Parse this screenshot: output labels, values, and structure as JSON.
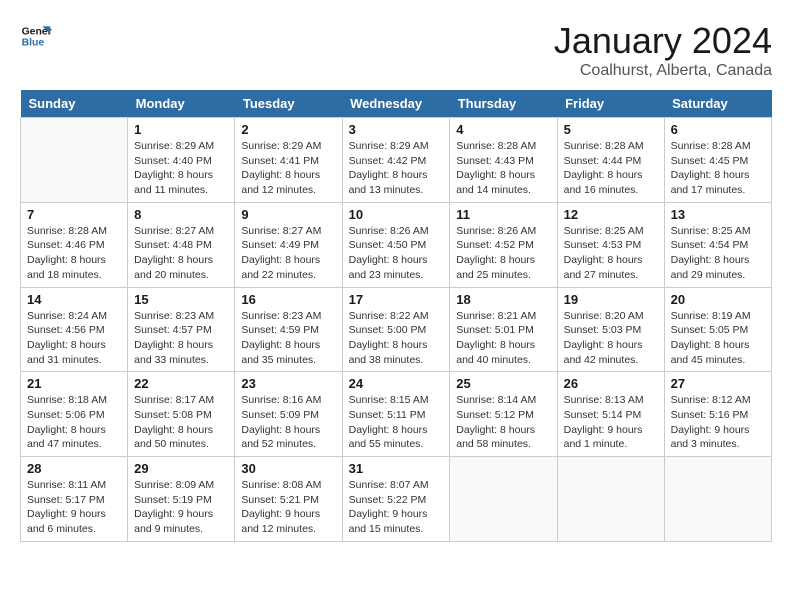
{
  "logo": {
    "line1": "General",
    "line2": "Blue"
  },
  "title": "January 2024",
  "subtitle": "Coalhurst, Alberta, Canada",
  "days_of_week": [
    "Sunday",
    "Monday",
    "Tuesday",
    "Wednesday",
    "Thursday",
    "Friday",
    "Saturday"
  ],
  "weeks": [
    [
      {
        "day": "",
        "info": ""
      },
      {
        "day": "1",
        "info": "Sunrise: 8:29 AM\nSunset: 4:40 PM\nDaylight: 8 hours\nand 11 minutes."
      },
      {
        "day": "2",
        "info": "Sunrise: 8:29 AM\nSunset: 4:41 PM\nDaylight: 8 hours\nand 12 minutes."
      },
      {
        "day": "3",
        "info": "Sunrise: 8:29 AM\nSunset: 4:42 PM\nDaylight: 8 hours\nand 13 minutes."
      },
      {
        "day": "4",
        "info": "Sunrise: 8:28 AM\nSunset: 4:43 PM\nDaylight: 8 hours\nand 14 minutes."
      },
      {
        "day": "5",
        "info": "Sunrise: 8:28 AM\nSunset: 4:44 PM\nDaylight: 8 hours\nand 16 minutes."
      },
      {
        "day": "6",
        "info": "Sunrise: 8:28 AM\nSunset: 4:45 PM\nDaylight: 8 hours\nand 17 minutes."
      }
    ],
    [
      {
        "day": "7",
        "info": "Sunrise: 8:28 AM\nSunset: 4:46 PM\nDaylight: 8 hours\nand 18 minutes."
      },
      {
        "day": "8",
        "info": "Sunrise: 8:27 AM\nSunset: 4:48 PM\nDaylight: 8 hours\nand 20 minutes."
      },
      {
        "day": "9",
        "info": "Sunrise: 8:27 AM\nSunset: 4:49 PM\nDaylight: 8 hours\nand 22 minutes."
      },
      {
        "day": "10",
        "info": "Sunrise: 8:26 AM\nSunset: 4:50 PM\nDaylight: 8 hours\nand 23 minutes."
      },
      {
        "day": "11",
        "info": "Sunrise: 8:26 AM\nSunset: 4:52 PM\nDaylight: 8 hours\nand 25 minutes."
      },
      {
        "day": "12",
        "info": "Sunrise: 8:25 AM\nSunset: 4:53 PM\nDaylight: 8 hours\nand 27 minutes."
      },
      {
        "day": "13",
        "info": "Sunrise: 8:25 AM\nSunset: 4:54 PM\nDaylight: 8 hours\nand 29 minutes."
      }
    ],
    [
      {
        "day": "14",
        "info": "Sunrise: 8:24 AM\nSunset: 4:56 PM\nDaylight: 8 hours\nand 31 minutes."
      },
      {
        "day": "15",
        "info": "Sunrise: 8:23 AM\nSunset: 4:57 PM\nDaylight: 8 hours\nand 33 minutes."
      },
      {
        "day": "16",
        "info": "Sunrise: 8:23 AM\nSunset: 4:59 PM\nDaylight: 8 hours\nand 35 minutes."
      },
      {
        "day": "17",
        "info": "Sunrise: 8:22 AM\nSunset: 5:00 PM\nDaylight: 8 hours\nand 38 minutes."
      },
      {
        "day": "18",
        "info": "Sunrise: 8:21 AM\nSunset: 5:01 PM\nDaylight: 8 hours\nand 40 minutes."
      },
      {
        "day": "19",
        "info": "Sunrise: 8:20 AM\nSunset: 5:03 PM\nDaylight: 8 hours\nand 42 minutes."
      },
      {
        "day": "20",
        "info": "Sunrise: 8:19 AM\nSunset: 5:05 PM\nDaylight: 8 hours\nand 45 minutes."
      }
    ],
    [
      {
        "day": "21",
        "info": "Sunrise: 8:18 AM\nSunset: 5:06 PM\nDaylight: 8 hours\nand 47 minutes."
      },
      {
        "day": "22",
        "info": "Sunrise: 8:17 AM\nSunset: 5:08 PM\nDaylight: 8 hours\nand 50 minutes."
      },
      {
        "day": "23",
        "info": "Sunrise: 8:16 AM\nSunset: 5:09 PM\nDaylight: 8 hours\nand 52 minutes."
      },
      {
        "day": "24",
        "info": "Sunrise: 8:15 AM\nSunset: 5:11 PM\nDaylight: 8 hours\nand 55 minutes."
      },
      {
        "day": "25",
        "info": "Sunrise: 8:14 AM\nSunset: 5:12 PM\nDaylight: 8 hours\nand 58 minutes."
      },
      {
        "day": "26",
        "info": "Sunrise: 8:13 AM\nSunset: 5:14 PM\nDaylight: 9 hours\nand 1 minute."
      },
      {
        "day": "27",
        "info": "Sunrise: 8:12 AM\nSunset: 5:16 PM\nDaylight: 9 hours\nand 3 minutes."
      }
    ],
    [
      {
        "day": "28",
        "info": "Sunrise: 8:11 AM\nSunset: 5:17 PM\nDaylight: 9 hours\nand 6 minutes."
      },
      {
        "day": "29",
        "info": "Sunrise: 8:09 AM\nSunset: 5:19 PM\nDaylight: 9 hours\nand 9 minutes."
      },
      {
        "day": "30",
        "info": "Sunrise: 8:08 AM\nSunset: 5:21 PM\nDaylight: 9 hours\nand 12 minutes."
      },
      {
        "day": "31",
        "info": "Sunrise: 8:07 AM\nSunset: 5:22 PM\nDaylight: 9 hours\nand 15 minutes."
      },
      {
        "day": "",
        "info": ""
      },
      {
        "day": "",
        "info": ""
      },
      {
        "day": "",
        "info": ""
      }
    ]
  ]
}
